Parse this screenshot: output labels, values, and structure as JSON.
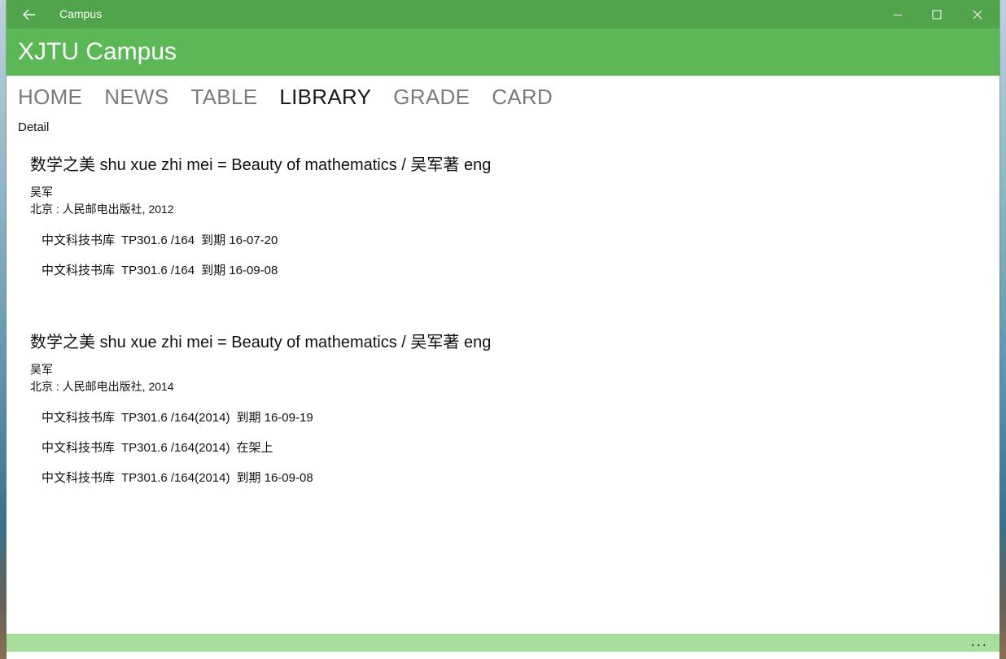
{
  "window": {
    "title": "Campus",
    "controls": {
      "back_icon": "arrow-left-icon",
      "minimize_icon": "minimize-icon",
      "maximize_icon": "maximize-icon",
      "close_icon": "close-icon"
    }
  },
  "app": {
    "title": "XJTU Campus",
    "accent_color": "#5cb757",
    "titlebar_color": "#51a34c",
    "bottombar_color": "#a6df9c"
  },
  "tabs": [
    {
      "label": "HOME",
      "active": false
    },
    {
      "label": "NEWS",
      "active": false
    },
    {
      "label": "TABLE",
      "active": false
    },
    {
      "label": "LIBRARY",
      "active": true
    },
    {
      "label": "GRADE",
      "active": false
    },
    {
      "label": "CARD",
      "active": false
    }
  ],
  "section_label": "Detail",
  "books": [
    {
      "title": "数学之美 shu xue zhi mei = Beauty of mathematics / 吴军著 eng",
      "author": "吴军",
      "publisher": "北京 : 人民邮电出版社, 2012",
      "holdings": [
        {
          "location": "中文科技书库",
          "call_number": "TP301.6 /164",
          "status": "到期 16-07-20"
        },
        {
          "location": "中文科技书库",
          "call_number": "TP301.6 /164",
          "status": "到期 16-09-08"
        }
      ]
    },
    {
      "title": "数学之美 shu xue zhi mei = Beauty of mathematics / 吴军著 eng",
      "author": "吴军",
      "publisher": "北京 : 人民邮电出版社, 2014",
      "holdings": [
        {
          "location": "中文科技书库",
          "call_number": "TP301.6 /164(2014)",
          "status": "到期 16-09-19"
        },
        {
          "location": "中文科技书库",
          "call_number": "TP301.6 /164(2014)",
          "status": "在架上"
        },
        {
          "location": "中文科技书库",
          "call_number": "TP301.6 /164(2014)",
          "status": "到期 16-09-08"
        }
      ]
    }
  ],
  "bottombar": {
    "more_label": "...",
    "more_icon": "more-icon"
  }
}
